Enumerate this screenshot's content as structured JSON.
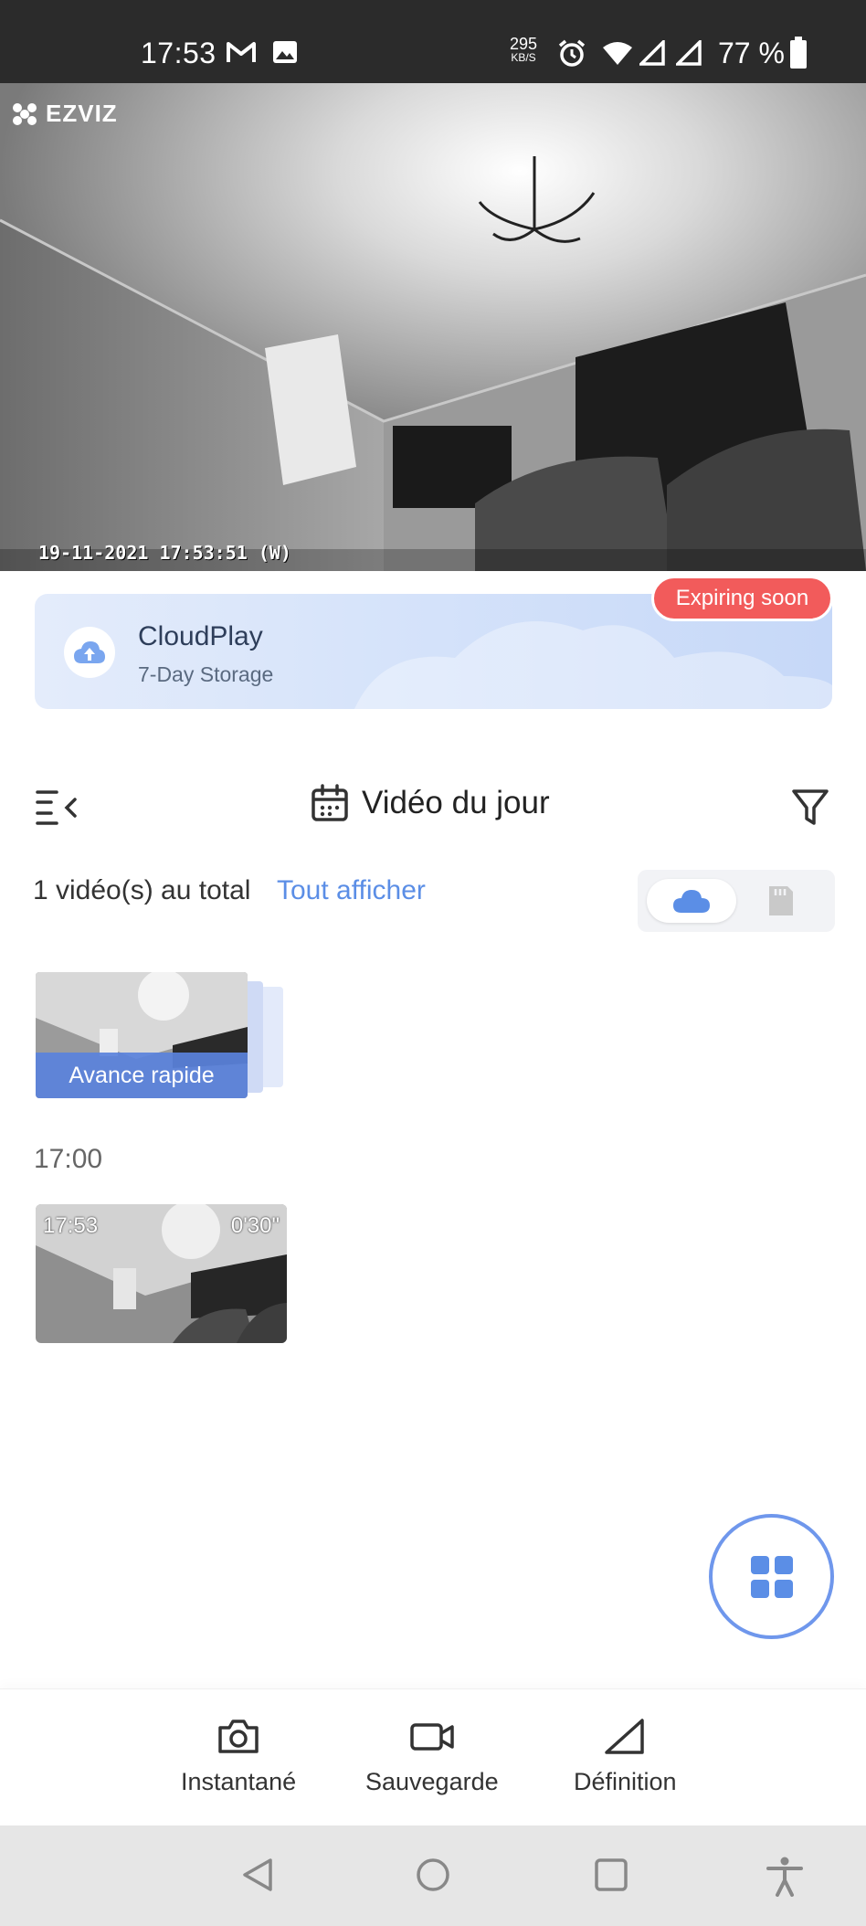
{
  "status_bar": {
    "time": "17:53",
    "net_speed_value": "295",
    "net_speed_unit": "KB/S",
    "battery": "77 %"
  },
  "feed": {
    "logo_text": "EZVIZ",
    "timestamp": "19-11-2021 17:53:51 (W)"
  },
  "cloud_banner": {
    "title": "CloudPlay",
    "subtitle": "7-Day Storage",
    "badge": "Expiring soon"
  },
  "toolbar": {
    "title": "Vidéo du jour"
  },
  "summary": {
    "total_label": "1 vidéo(s) au total",
    "show_all": "Tout afficher"
  },
  "fast_forward": {
    "label": "Avance rapide"
  },
  "timeline": {
    "hour": "17:00",
    "clips": [
      {
        "time": "17:53",
        "duration": "0'30\""
      }
    ]
  },
  "actions": [
    {
      "label": "Instantané",
      "icon": "camera-icon"
    },
    {
      "label": "Sauvegarde",
      "icon": "video-icon"
    },
    {
      "label": "Définition",
      "icon": "definition-icon"
    }
  ],
  "colors": {
    "accent": "#5b8ee6",
    "badge": "#f25b5b",
    "fab_border": "#6f97ec"
  }
}
